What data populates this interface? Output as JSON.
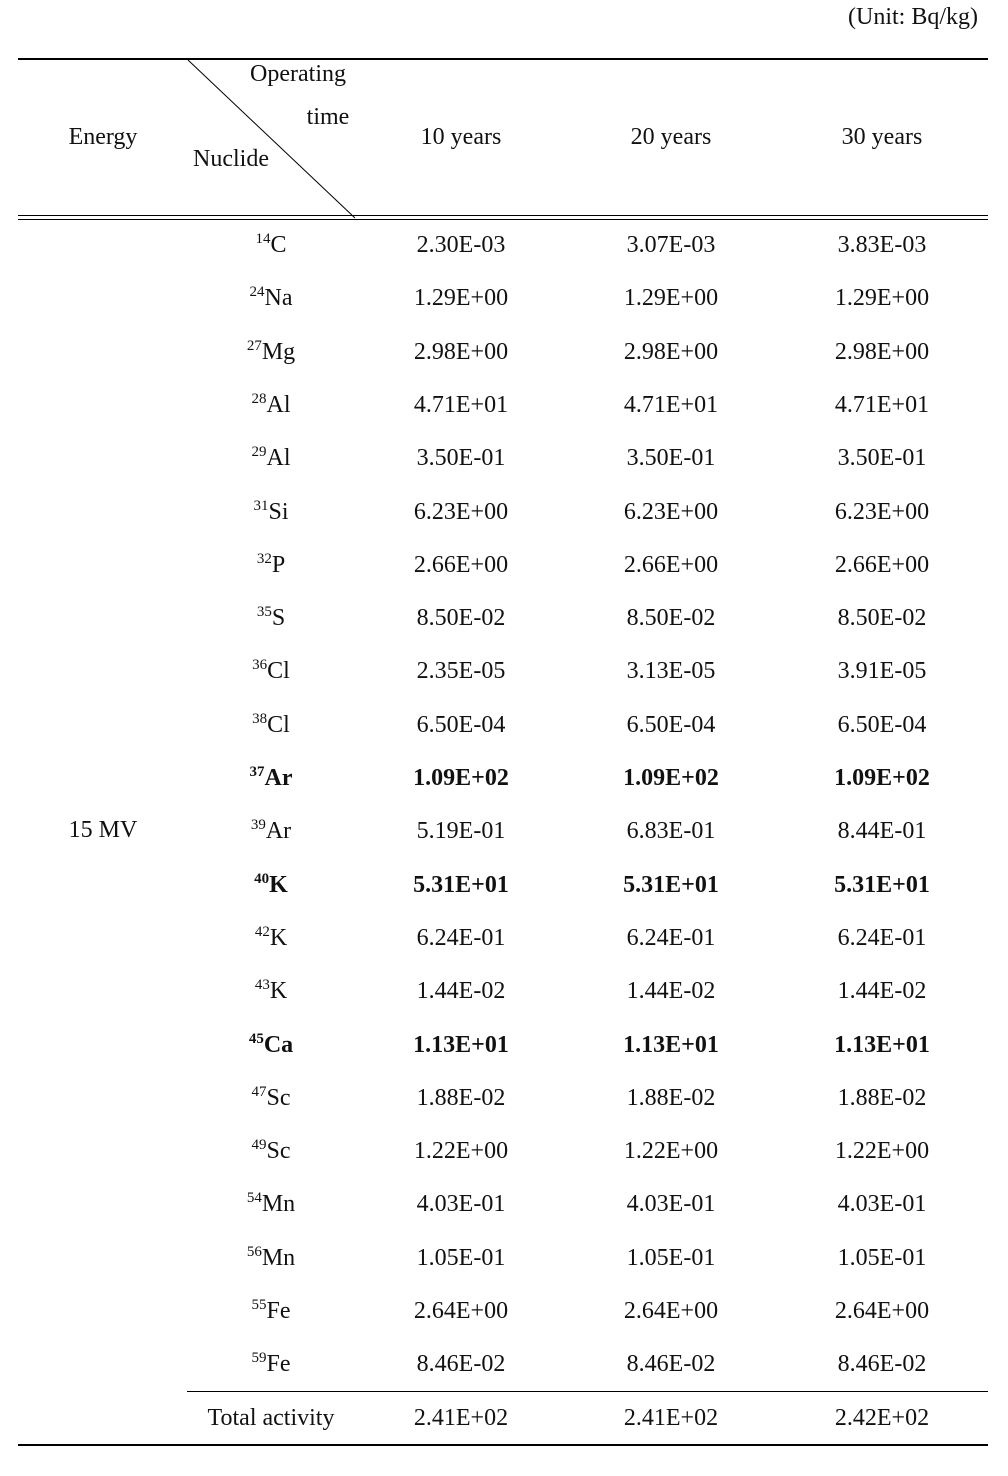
{
  "unit_label": "(Unit: Bq/kg)",
  "header": {
    "energy": "Energy",
    "operating_line1": "Operating",
    "operating_line2": "time",
    "nuclide": "Nuclide",
    "columns": [
      "10 years",
      "20 years",
      "30 years"
    ]
  },
  "energy_value": "15 MV",
  "rows": [
    {
      "mass": "14",
      "element": "C",
      "values": [
        "2.30E-03",
        "3.07E-03",
        "3.83E-03"
      ]
    },
    {
      "mass": "24",
      "element": "Na",
      "values": [
        "1.29E+00",
        "1.29E+00",
        "1.29E+00"
      ]
    },
    {
      "mass": "27",
      "element": "Mg",
      "values": [
        "2.98E+00",
        "2.98E+00",
        "2.98E+00"
      ]
    },
    {
      "mass": "28",
      "element": "Al",
      "values": [
        "4.71E+01",
        "4.71E+01",
        "4.71E+01"
      ]
    },
    {
      "mass": "29",
      "element": "Al",
      "values": [
        "3.50E-01",
        "3.50E-01",
        "3.50E-01"
      ]
    },
    {
      "mass": "31",
      "element": "Si",
      "values": [
        "6.23E+00",
        "6.23E+00",
        "6.23E+00"
      ]
    },
    {
      "mass": "32",
      "element": "P",
      "values": [
        "2.66E+00",
        "2.66E+00",
        "2.66E+00"
      ]
    },
    {
      "mass": "35",
      "element": "S",
      "values": [
        "8.50E-02",
        "8.50E-02",
        "8.50E-02"
      ]
    },
    {
      "mass": "36",
      "element": "Cl",
      "values": [
        "2.35E-05",
        "3.13E-05",
        "3.91E-05"
      ]
    },
    {
      "mass": "38",
      "element": "Cl",
      "values": [
        "6.50E-04",
        "6.50E-04",
        "6.50E-04"
      ]
    },
    {
      "mass": "37",
      "element": "Ar",
      "values": [
        "1.09E+02",
        "1.09E+02",
        "1.09E+02"
      ],
      "bold": true
    },
    {
      "mass": "39",
      "element": "Ar",
      "values": [
        "5.19E-01",
        "6.83E-01",
        "8.44E-01"
      ]
    },
    {
      "mass": "40",
      "element": "K",
      "values": [
        "5.31E+01",
        "5.31E+01",
        "5.31E+01"
      ],
      "bold": true
    },
    {
      "mass": "42",
      "element": "K",
      "values": [
        "6.24E-01",
        "6.24E-01",
        "6.24E-01"
      ]
    },
    {
      "mass": "43",
      "element": "K",
      "values": [
        "1.44E-02",
        "1.44E-02",
        "1.44E-02"
      ]
    },
    {
      "mass": "45",
      "element": "Ca",
      "values": [
        "1.13E+01",
        "1.13E+01",
        "1.13E+01"
      ],
      "bold": true
    },
    {
      "mass": "47",
      "element": "Sc",
      "values": [
        "1.88E-02",
        "1.88E-02",
        "1.88E-02"
      ]
    },
    {
      "mass": "49",
      "element": "Sc",
      "values": [
        "1.22E+00",
        "1.22E+00",
        "1.22E+00"
      ]
    },
    {
      "mass": "54",
      "element": "Mn",
      "values": [
        "4.03E-01",
        "4.03E-01",
        "4.03E-01"
      ]
    },
    {
      "mass": "56",
      "element": "Mn",
      "values": [
        "1.05E-01",
        "1.05E-01",
        "1.05E-01"
      ]
    },
    {
      "mass": "55",
      "element": "Fe",
      "values": [
        "2.64E+00",
        "2.64E+00",
        "2.64E+00"
      ]
    },
    {
      "mass": "59",
      "element": "Fe",
      "values": [
        "8.46E-02",
        "8.46E-02",
        "8.46E-02"
      ]
    }
  ],
  "total": {
    "label": "Total activity",
    "values": [
      "2.41E+02",
      "2.41E+02",
      "2.42E+02"
    ]
  }
}
